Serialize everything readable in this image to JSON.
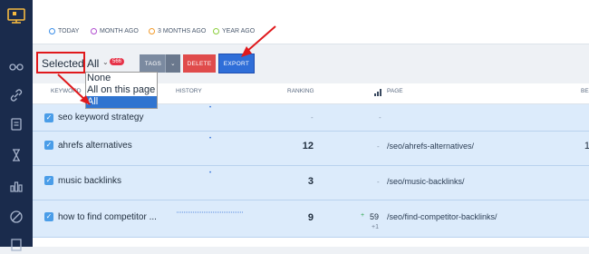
{
  "legend": {
    "today": "TODAY",
    "month_ago": "MONTH AGO",
    "three_months_ago": "3 MONTHS AGO",
    "year_ago": "YEAR AGO"
  },
  "colors": {
    "today": "#3b8ee8",
    "month_ago": "#b24fd1",
    "three_months_ago": "#f29b2c",
    "year_ago": "#8ccf3c"
  },
  "toolbar": {
    "selected_label": "Selected",
    "selected_value": "All",
    "count_badge": "566",
    "tags_label": "TAGS",
    "delete_label": "DELETE",
    "export_label": "EXPORT"
  },
  "dropdown": {
    "options": [
      "None",
      "All on this page",
      "All"
    ],
    "selected": "All"
  },
  "columns": {
    "keyword": "KEYWORD",
    "history": "HISTORY",
    "ranking": "RANKING",
    "page": "PAGE",
    "cut": "BE"
  },
  "rows": [
    {
      "keyword": "seo keyword strategy",
      "ranking": "-",
      "delta": "",
      "page": "-"
    },
    {
      "keyword": "ahrefs alternatives",
      "ranking": "12",
      "delta": "-",
      "page": "/seo/ahrefs-alternatives/",
      "extra": "1"
    },
    {
      "keyword": "music backlinks",
      "ranking": "3",
      "delta": "-",
      "page": "/seo/music-backlinks/"
    },
    {
      "keyword": "how to find competitor ...",
      "ranking": "9",
      "delta_up": "+",
      "delta_value": "59",
      "delta_sub": "+1",
      "page": "/seo/find-competitor-backlinks/"
    }
  ]
}
